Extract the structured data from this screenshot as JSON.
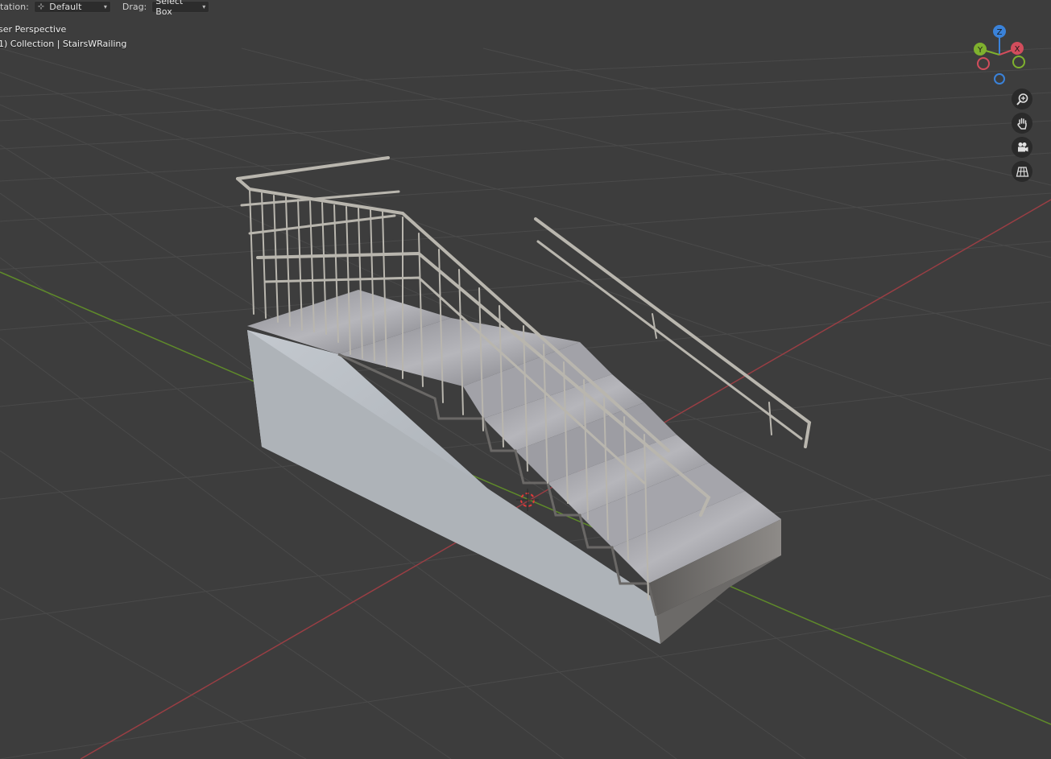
{
  "header": {
    "orientation_label": "tation:",
    "orientation_value": "Default",
    "drag_label": "Drag:",
    "drag_value": "Select Box"
  },
  "viewport_info": {
    "view_name": "ser Perspective",
    "collection_line": "1) Collection | StairsWRailing"
  },
  "gizmo": {
    "axes": {
      "z": "Z",
      "y": "Y",
      "x": "X"
    },
    "colors": {
      "x": "#d24d5c",
      "y": "#7fb12e",
      "z": "#3a82d9"
    }
  },
  "nav_buttons": [
    "zoom-icon",
    "pan-hand-icon",
    "camera-icon",
    "ortho-grid-icon"
  ],
  "scene": {
    "object": "StairsWRailing"
  }
}
